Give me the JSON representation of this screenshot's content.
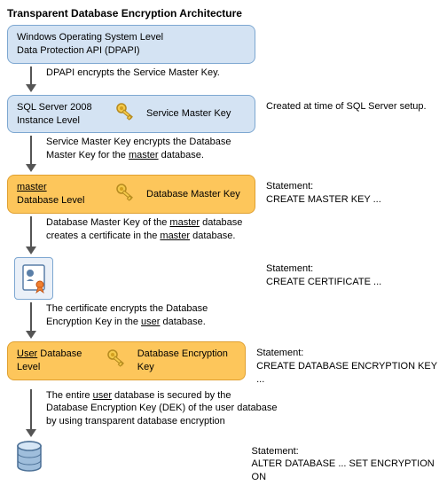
{
  "title": "Transparent Database Encryption Architecture",
  "box1": {
    "line1": "Windows Operating System Level",
    "line2": "Data Protection API (DPAPI)"
  },
  "arrow1": "DPAPI encrypts the Service Master Key.",
  "box2": {
    "left1": "SQL Server 2008",
    "left2": "Instance Level",
    "right": "Service Master Key"
  },
  "side2": "Created at time of SQL Server setup.",
  "arrow2a": "Service Master Key encrypts the Database",
  "arrow2b_pre": "Master Key for the ",
  "arrow2b_u": "master",
  "arrow2b_post": " database.",
  "box3": {
    "left1_u": "master",
    "left2": "Database Level",
    "right": "Database Master Key"
  },
  "side3a": "Statement:",
  "side3b": "CREATE MASTER KEY ...",
  "arrow3a_pre": "Database Master Key of the ",
  "arrow3a_u": "master",
  "arrow3a_post": " database",
  "arrow3b_pre": "creates a certificate in the ",
  "arrow3b_u": "master",
  "arrow3b_post": " database.",
  "side4a": "Statement:",
  "side4b": "CREATE CERTIFICATE ...",
  "arrow4a": "The certificate encrypts the Database",
  "arrow4b_pre": "Encryption Key in the ",
  "arrow4b_u": "user",
  "arrow4b_post": " database.",
  "box5": {
    "left1_u": "User",
    "left1_post": " Database",
    "left2": "Level",
    "right": "Database Encryption Key"
  },
  "side5a": "Statement:",
  "side5b": "CREATE DATABASE ENCRYPTION KEY ...",
  "arrow5a_pre": "The entire ",
  "arrow5a_u": "user",
  "arrow5a_post": " database is secured by the",
  "arrow5b": "Database Encryption Key (DEK) of the user database",
  "arrow5c": "by using transparent database encryption",
  "side6a": "Statement:",
  "side6b": "ALTER DATABASE ... SET ENCRYPTION ON"
}
